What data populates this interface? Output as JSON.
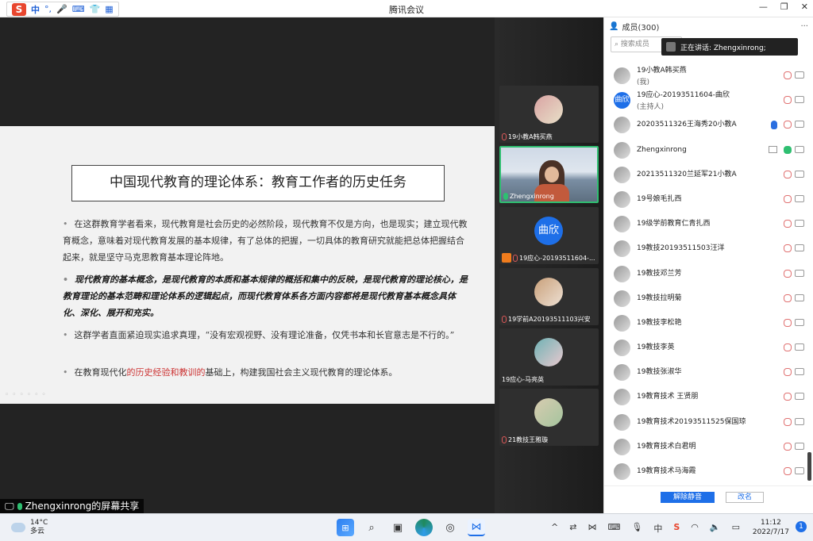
{
  "titlebar": {
    "app_title": "腾讯会议",
    "ime_mode": "中",
    "ime_punct": "°,",
    "win_min": "—",
    "win_max": "❐",
    "win_close": "✕"
  },
  "slide": {
    "title": "中国现代教育的理论体系：教育工作者的历史任务",
    "p1": "在这群教育学者看来，现代教育是社会历史的必然阶段，现代教育不仅是方向，也是现实；建立现代教育概念，意味着对现代教育发展的基本规律，有了总体的把握，一切具体的教育研究就能把总体把握结合起来，就是坚守马克思教育基本理论阵地。",
    "p2": "现代教育的基本概念，是现代教育的本质和基本规律的概括和集中的反映，是现代教育的理论核心，是教育理论的基本范畴和理论体系的逻辑起点，而现代教育体系各方面内容都将是现代教育基本概念具体化、深化、展开和充实。",
    "p3": "这群学者直面紧迫现实追求真理，“没有宏观视野、没有理论准备，仅凭书本和长官意志是不行的。”",
    "p4_pre": "在教育现代化",
    "p4_red": "的历史经验和教训的",
    "p4_post": "基础上，构建我国社会主义现代教育的理论体系。"
  },
  "share_bar": {
    "label": "Zhengxinrong的屏幕共享"
  },
  "video_tiles": [
    {
      "name": "19小教A韩买燕"
    },
    {
      "name": "Zhengxinrong"
    },
    {
      "name": "19应心-20193511604-...",
      "avatar_text": "曲欣"
    },
    {
      "name": "19学前A20193511103兴安"
    },
    {
      "name": "19应心-马亮英"
    },
    {
      "name": "21教技王雅璇"
    }
  ],
  "panel": {
    "header": "成员(300)",
    "more": "···",
    "search_placeholder": "搜索成员",
    "speaking": "正在讲话: Zhengxinrong;",
    "members": [
      {
        "name": "19小教A韩买燕",
        "role": "(我)"
      },
      {
        "name": "19应心-20193511604-曲欣",
        "role": "(主持人)",
        "avatar_text": "曲欣"
      },
      {
        "name": "20203511326王海秀20小教A"
      },
      {
        "name": "Zhengxinrong"
      },
      {
        "name": "20213511320兰延军21小教A"
      },
      {
        "name": "19号娘毛扎西"
      },
      {
        "name": "19级学前教育仁青扎西"
      },
      {
        "name": "19教技20193511503汪洋"
      },
      {
        "name": "19教技邓兰芳"
      },
      {
        "name": "19教技拉明菊"
      },
      {
        "name": "19教技李松艳"
      },
      {
        "name": "19教技李英"
      },
      {
        "name": "19教技张淑华"
      },
      {
        "name": "19教育技术 王贤朋"
      },
      {
        "name": "19教育技术20193511525保国琼"
      },
      {
        "name": "19教育技术白君明"
      },
      {
        "name": "19教育技术马海霞"
      }
    ],
    "unmute_all": "解除静音",
    "rename": "改名"
  },
  "taskbar": {
    "temp": "14°C",
    "weather": "多云",
    "time": "11:12",
    "date": "2022/7/17",
    "notifications": "1",
    "ime": "中"
  }
}
